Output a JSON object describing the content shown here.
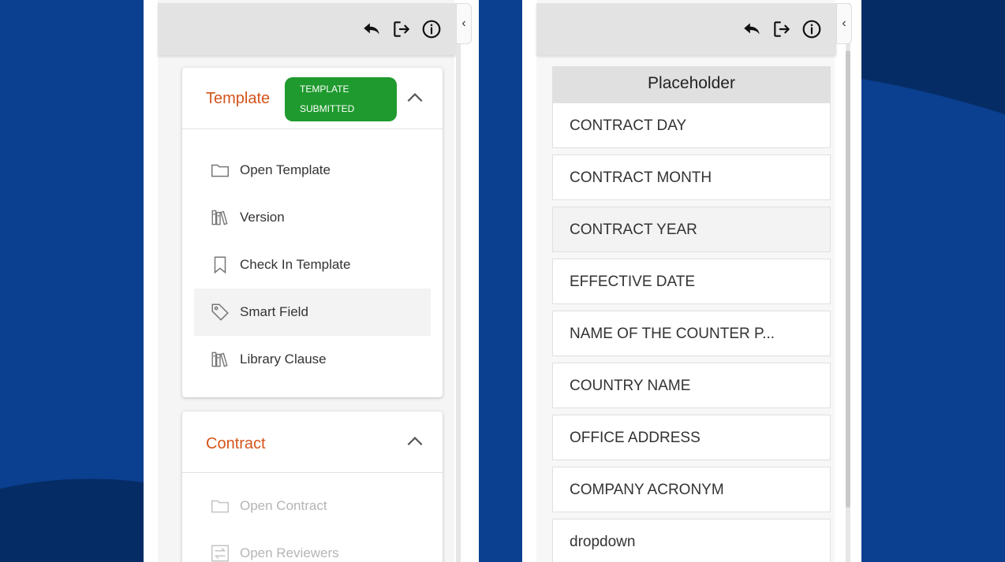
{
  "template_card": {
    "title": "Template",
    "badge_line1": "Template",
    "badge_line2": "Submitted",
    "badge_color": "#1f9a2e",
    "items": [
      {
        "label": "Open Template",
        "icon": "folder-icon"
      },
      {
        "label": "Version",
        "icon": "books-icon"
      },
      {
        "label": "Check In Template",
        "icon": "bookmark-icon"
      },
      {
        "label": "Smart Field",
        "icon": "tag-icon"
      },
      {
        "label": "Library Clause",
        "icon": "books-icon"
      }
    ]
  },
  "contract_card": {
    "title": "Contract",
    "items": [
      {
        "label": "Open Contract",
        "icon": "folder-icon"
      },
      {
        "label": "Open Reviewers",
        "icon": "swap-icon"
      }
    ]
  },
  "placeholder_panel": {
    "header": "Placeholder",
    "rows": [
      "CONTRACT DAY",
      "CONTRACT MONTH",
      "CONTRACT YEAR",
      "EFFECTIVE DATE",
      "NAME OF THE COUNTER P...",
      "COUNTRY NAME",
      "OFFICE ADDRESS",
      "COMPANY ACRONYM",
      "dropdown"
    ]
  },
  "toolbar": {
    "icons": [
      "reply-icon",
      "exit-icon",
      "info-icon"
    ],
    "collapse_glyph": "‹"
  },
  "colors": {
    "accent": "#d4541b",
    "background": "#0b3f8f"
  }
}
